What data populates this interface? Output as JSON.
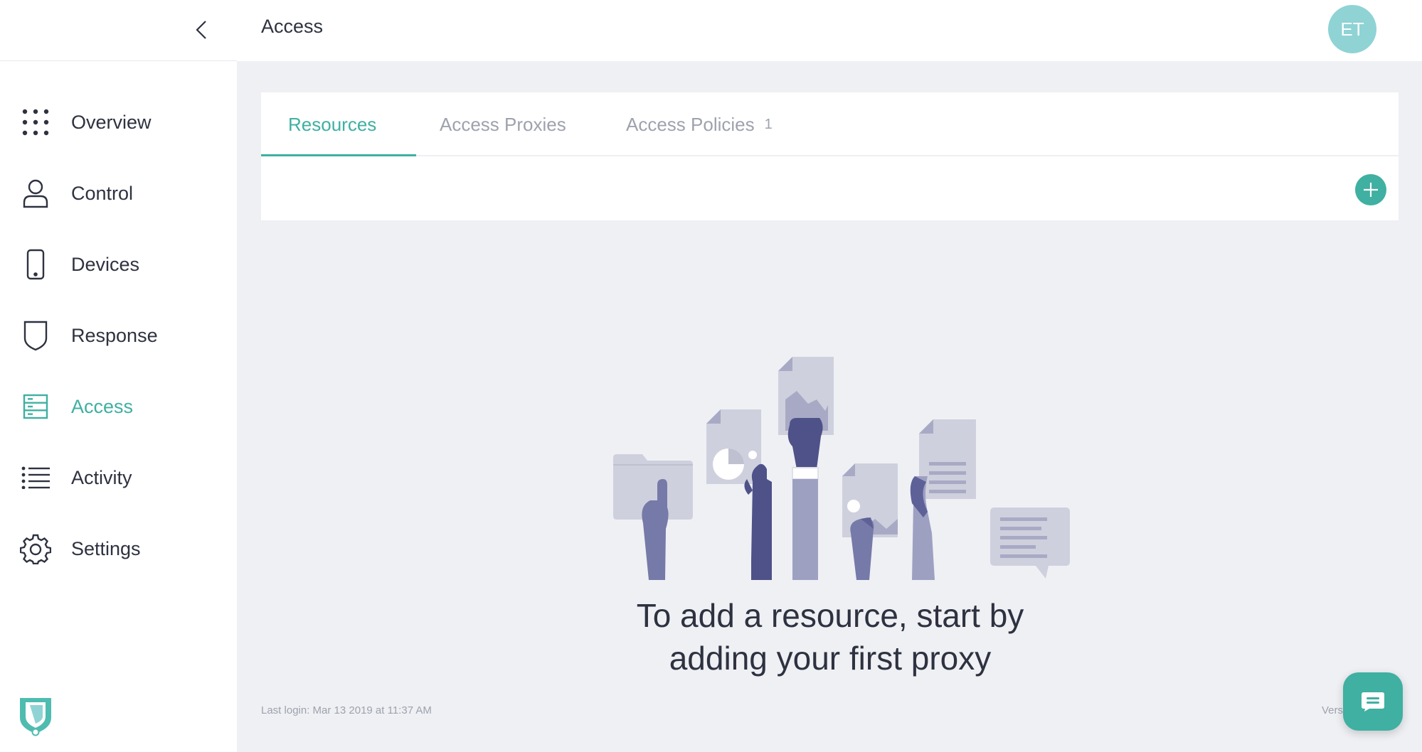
{
  "colors": {
    "accent": "#3fb0a1",
    "avatar_bg": "#8fd3d5",
    "text": "#2e3240",
    "muted": "#9ea2ad"
  },
  "sidebar": {
    "collapse_icon": "chevron-left-icon",
    "items": [
      {
        "label": "Overview",
        "icon": "grid-dots-icon",
        "active": false
      },
      {
        "label": "Control",
        "icon": "user-icon",
        "active": false
      },
      {
        "label": "Devices",
        "icon": "phone-icon",
        "active": false
      },
      {
        "label": "Response",
        "icon": "shield-icon",
        "active": false
      },
      {
        "label": "Access",
        "icon": "server-icon",
        "active": true
      },
      {
        "label": "Activity",
        "icon": "list-icon",
        "active": false
      },
      {
        "label": "Settings",
        "icon": "gear-icon",
        "active": false
      }
    ],
    "logo": "shield-logo"
  },
  "header": {
    "title": "Access",
    "avatar_initials": "ET"
  },
  "tabs": [
    {
      "label": "Resources",
      "active": true
    },
    {
      "label": "Access Proxies",
      "active": false
    },
    {
      "label": "Access Policies",
      "count": "1",
      "active": false
    }
  ],
  "empty_state": {
    "line1": "To add a resource, start by",
    "line2": "adding your first proxy"
  },
  "footer": {
    "last_login": "Last login: Mar 13 2019 at 11:37 AM",
    "version": "Vers"
  }
}
